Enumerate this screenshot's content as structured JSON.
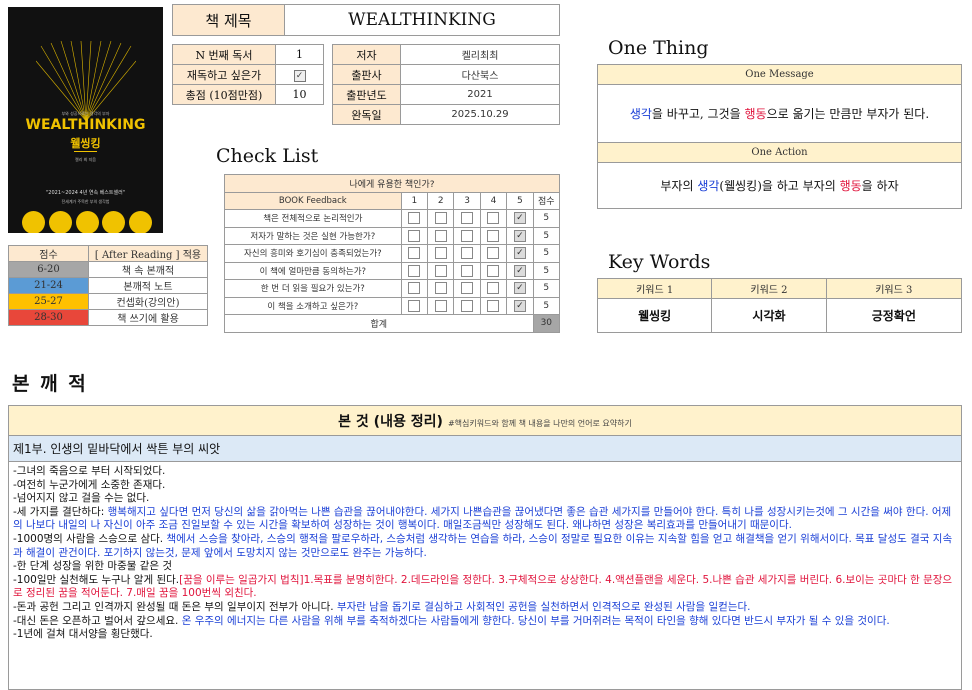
{
  "cover": {
    "top_text": "부와 성공으로는 생각의 부자",
    "title_en": "WEALTHINKING",
    "title_ko": "웰씽킹",
    "author": "켈리 최 지음",
    "promo_1": "\"2021~2024 4년 연속 베스트셀러\"",
    "promo_2": "전세계가 주목한 부의 생각법"
  },
  "title": {
    "label": "책 제목",
    "value": "WEALTHINKING"
  },
  "info_left": [
    {
      "label": "N 번째 독서",
      "value": "1"
    },
    {
      "label": "재독하고 싶은가",
      "value": "✓"
    },
    {
      "label": "총점 (10점만점)",
      "value": "10"
    }
  ],
  "info_right": [
    {
      "label": "저자",
      "value": "켈리최최"
    },
    {
      "label": "출판사",
      "value": "다산북스"
    },
    {
      "label": "출판년도",
      "value": "2021"
    },
    {
      "label": "완독일",
      "value": "2025.10.29"
    }
  ],
  "one_thing": {
    "heading": "One Thing",
    "message_label": "One Message",
    "message": {
      "p1": "생각",
      "p2": "을 바꾸고, 그것을 ",
      "p3": "행동",
      "p4": "으로 옮기는 만큼만 부자가 된다."
    },
    "action_label": "One Action",
    "action": {
      "p1": "부자의 ",
      "p2": "생각",
      "p3": "(웰씽킹)을 하고 부자의 ",
      "p4": "행동",
      "p5": "을 하자"
    }
  },
  "score_legend": {
    "header": [
      "점수",
      "[ After Reading ] 적용"
    ],
    "rows": [
      {
        "range": "6-20",
        "label": "책 속 본깨적",
        "color": "#a6a6a6"
      },
      {
        "range": "21-24",
        "label": "본깨적 노트",
        "color": "#5b9bd5"
      },
      {
        "range": "25-27",
        "label": "컨셉화(강의안)",
        "color": "#ffc000"
      },
      {
        "range": "28-30",
        "label": "책 쓰기에 활용",
        "color": "#e8473a"
      }
    ]
  },
  "check_list": {
    "heading": "Check List",
    "title": "나에게 유용한 책인가?",
    "col_feedback": "BOOK Feedback",
    "cols": [
      "1",
      "2",
      "3",
      "4",
      "5"
    ],
    "col_score": "점수",
    "questions": [
      {
        "q": "책은 전체적으로 논리적인가",
        "score": "5"
      },
      {
        "q": "저자가 말하는 것은 실현 가능한가?",
        "score": "5"
      },
      {
        "q": "자신의 흥미와 호기심이 충족되었는가?",
        "score": "5"
      },
      {
        "q": "이 책에 얼마만큼 동의하는가?",
        "score": "5"
      },
      {
        "q": "한 번 더 읽을 필요가 있는가?",
        "score": "5"
      },
      {
        "q": "이 책을 소개하고 싶은가?",
        "score": "5"
      }
    ],
    "total_label": "합계",
    "total": "30"
  },
  "key_words": {
    "heading": "Key Words",
    "labels": [
      "키워드 1",
      "키워드 2",
      "키워드 3"
    ],
    "values": [
      "웰씽킹",
      "시각화",
      "긍정확언"
    ]
  },
  "section": {
    "heading": "본 깨 적",
    "box_title": "본 것 (내용 정리)",
    "box_subtitle": "#핵심키워드와 함께 책 내용을 나만의 언어로 요약하기",
    "part_title": "제1부. 인생의 밑바닥에서 싹튼 부의 씨앗",
    "l1": "-그녀의 죽음으로 부터 시작되었다.",
    "l2": "-여전히 누군가에게 소중한 존재다.",
    "l3": "-넘어지지 않고 걸을 수는 없다.",
    "l4a": "-세 가지를 결단하다: ",
    "l4b": "행복해지고 싶다면 먼저 당신의 삶을 갉아먹는 나쁜 습관을 끊어내야한다. 세가지 나쁜습관을 끊어냈다면 좋은 습관 세가지를 만들어야 한다. 특히 나를 성장시키는것에 그 시간을 써야 한다. 어제의 나보다 내일의 나 자신이 아주 조금 진일보할 수 있는 시간을 확보하여 성장하는 것이 행복이다. 매일조금씩만 성장해도 된다. 왜냐하면 성장은 복리효과를 만들어내기 때문이다.",
    "l5a": "-1000명의 사람을 스승으로 삼다. ",
    "l5b": "책에서 스승을 찾아라, 스승의 행적을 팔로우하라, 스승처럼 생각하는 연습을 하라, 스승이 정말로 필요한 이유는 지속할 힘을 얻고 해결책을 얻기 위해서이다. 목표 달성도 결국 지속과 해결이 관건이다. 포기하지 않는것, 문제 앞에서 도망치지 않는 것만으로도 완주는 가능하다.",
    "l6": "-한 단계 성장을 위한 마중물 같은 것",
    "l7a": "-100일만 실천해도 누구나 알게 된다.",
    "l7b": "[꿈을 이루는 일곱가지 법칙]1.목표를 분명히한다. 2.데드라인을 정한다. 3.구체적으로 상상한다. 4.액션플랜을 세운다. 5.나쁜 습관 세가지를 버린다. 6.보이는 곳마다 한 문장으로 정리된 꿈을 적어둔다. 7.매일 꿈을 100번씩 외친다.",
    "l8a": "-돈과 공헌 그리고 인격까지 완성될 때 돈은 부의 일부이지 전부가 아니다. ",
    "l8b": "부자란 남을 돕기로 결심하고 사회적인 공헌을 실천하면서 인격적으로 완성된 사람을 일컫는다.",
    "l9a": "-대신 돈은 오픈하고 벌어서 갚으세요. ",
    "l9b": "온 우주의 에너지는 다른 사람을 위해 부를 축적하겠다는 사람들에게 향한다. 당신이 부를 거머쥐려는 목적이 타인을 향해 있다면 반드시 부자가 될 수 있을 것이다.",
    "l10": "-1년에 걸쳐 대서양을 횡단했다."
  }
}
